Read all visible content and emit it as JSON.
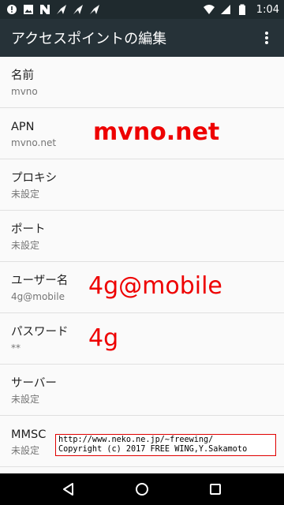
{
  "status_bar": {
    "time": "1:04",
    "left_icons": [
      "alert-icon",
      "image-icon",
      "n-icon",
      "send-icon",
      "send-icon",
      "send-icon"
    ],
    "right_icons": [
      "wifi-icon",
      "signal-icon",
      "battery-icon"
    ]
  },
  "app_bar": {
    "title": "アクセスポイントの編集",
    "overflow_icon": "more-vert-icon"
  },
  "prefs": [
    {
      "title": "名前",
      "summary": "mvno"
    },
    {
      "title": "APN",
      "summary": "mvno.net"
    },
    {
      "title": "プロキシ",
      "summary": "未設定"
    },
    {
      "title": "ポート",
      "summary": "未設定"
    },
    {
      "title": "ユーザー名",
      "summary": "4g@mobile"
    },
    {
      "title": "パスワード",
      "summary": "**"
    },
    {
      "title": "サーバー",
      "summary": "未設定"
    },
    {
      "title": "MMSC",
      "summary": "未設定"
    }
  ],
  "annotations": {
    "apn": "mvno.net",
    "username": "4g@mobile",
    "password": "4g"
  },
  "copyright": {
    "line1": "http://www.neko.ne.jp/~freewing/",
    "line2": "Copyright (c) 2017 FREE WING,Y.Sakamoto"
  },
  "nav_bar": {
    "icons": [
      "back-icon",
      "home-icon",
      "recents-icon"
    ]
  },
  "colors": {
    "status_bar": "#1f2a2e",
    "app_bar": "#263238",
    "annotation": "#ee0000",
    "nav_bar": "#000000"
  }
}
